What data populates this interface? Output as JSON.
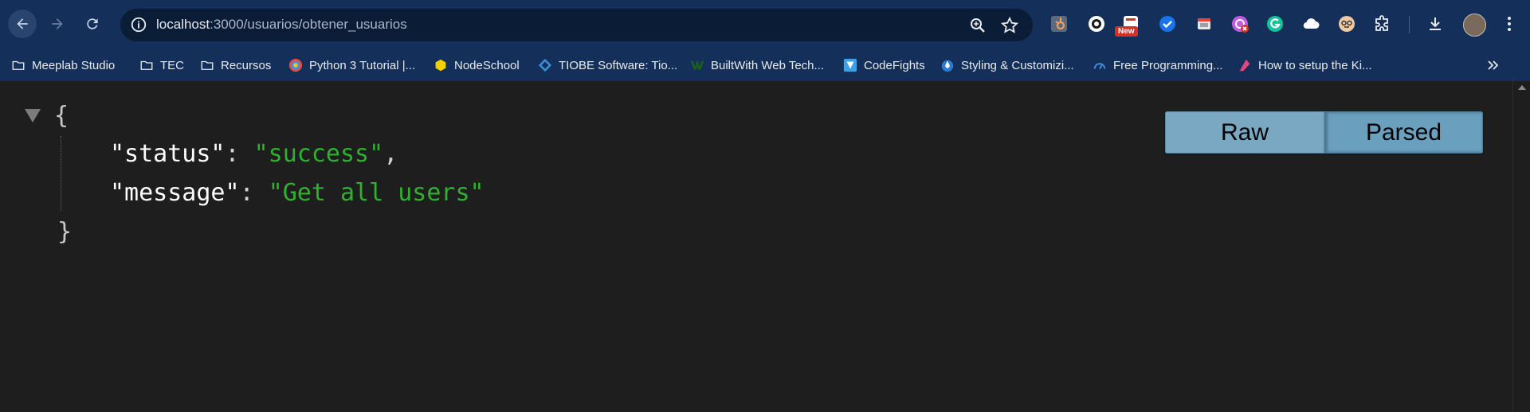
{
  "browser": {
    "url_host": "localhost",
    "url_path": ":3000/usuarios/obtener_usuarios",
    "extension_badge": "New",
    "icons": [
      "back-arrow-icon",
      "forward-arrow-icon",
      "reload-icon",
      "site-info-icon",
      "zoom-icon",
      "star-icon",
      "hubspot-icon",
      "extension-icon",
      "new-extension-icon",
      "check-icon",
      "window-icon",
      "pomodoro-icon",
      "grammarly-icon",
      "cloud-icon",
      "face-icon",
      "puzzle-icon",
      "download-icon",
      "menu-icon"
    ]
  },
  "bookmarks": [
    {
      "label": "Meeplab Studio",
      "icon": "folder-icon"
    },
    {
      "label": "TEC",
      "icon": "folder-icon"
    },
    {
      "label": "Recursos",
      "icon": "folder-icon"
    },
    {
      "label": "Python 3 Tutorial |...",
      "icon": "python-icon"
    },
    {
      "label": "NodeSchool",
      "icon": "hexagon-icon"
    },
    {
      "label": "TIOBE Software: Tio...",
      "icon": "tiobe-icon"
    },
    {
      "label": "BuiltWith Web Tech...",
      "icon": "builtwith-icon"
    },
    {
      "label": "CodeFights",
      "icon": "codefights-icon"
    },
    {
      "label": "Styling & Customizi...",
      "icon": "drop-icon"
    },
    {
      "label": "Free Programming...",
      "icon": "cloud-gauge-icon"
    },
    {
      "label": "How to setup the Ki...",
      "icon": "kite-icon"
    }
  ],
  "json_view": {
    "open_brace": "{",
    "close_brace": "}",
    "lines": [
      {
        "key": "\"status\"",
        "colon": ": ",
        "value": "\"success\"",
        "comma": ","
      },
      {
        "key": "\"message\"",
        "colon": ": ",
        "value": "\"Get all users\"",
        "comma": ""
      }
    ]
  },
  "view_toggle": {
    "raw": "Raw",
    "parsed": "Parsed",
    "selected": "Parsed"
  }
}
